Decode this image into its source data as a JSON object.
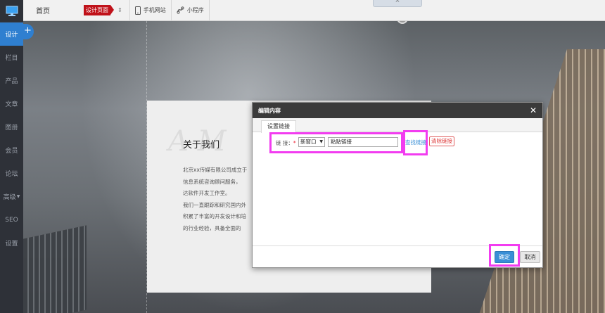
{
  "sidebar": {
    "items": [
      {
        "label": "设计",
        "active": true
      },
      {
        "label": "栏目"
      },
      {
        "label": "产品"
      },
      {
        "label": "文章"
      },
      {
        "label": "图册"
      },
      {
        "label": "会员"
      },
      {
        "label": "论坛"
      },
      {
        "label": "高级"
      },
      {
        "label": "SEO"
      },
      {
        "label": "设置"
      }
    ],
    "add_label": "+"
  },
  "topbar": {
    "home_label": "首页",
    "page_badge": "设计页面",
    "mobile_label": "手机网站",
    "miniapp_label": "小程序",
    "collapse_label": "^"
  },
  "about": {
    "title": "关于我们",
    "lines": [
      "北京xx传媒有限公司成立于",
      "信息系统咨询顾问服务，",
      "达软件开发工作室。",
      "我们一直跟踪和研究国内外",
      "积累了丰富的开发设计和培",
      "的行业经验，具备全面的"
    ]
  },
  "modal": {
    "title": "编辑内容",
    "close_label": "✕",
    "tab_label": "设置链接",
    "link_label": "链 接：",
    "required_mark": "*",
    "target_select": "新窗口",
    "link_value": "粘贴链接",
    "find_link": "查找链接",
    "clear_link": "清除链接",
    "ok_label": "确定",
    "cancel_label": "取消"
  },
  "colors": {
    "accent": "#2f7fd0",
    "highlight": "#f23cf0",
    "badge": "#c0121a"
  }
}
